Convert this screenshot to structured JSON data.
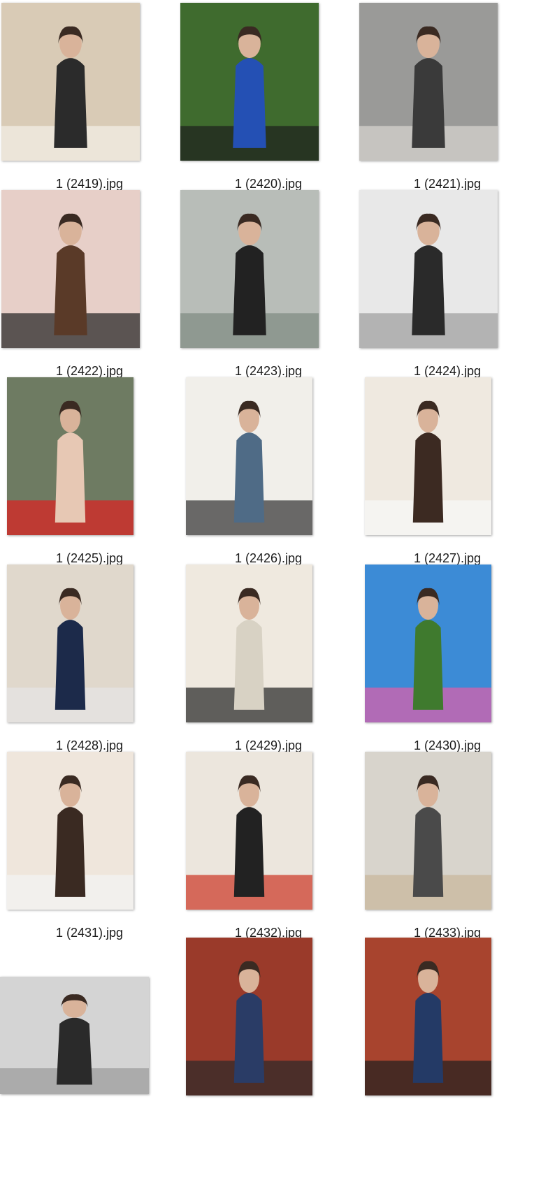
{
  "window": {
    "view": "File Explorer thumbnail view (large icons)"
  },
  "files": [
    {
      "name": "1 (2419).jpg",
      "thumb": {
        "orientation": "portrait",
        "palette": [
          "#d9cbb6",
          "#2b2b2b",
          "#f3efe8"
        ]
      }
    },
    {
      "name": "1 (2420).jpg",
      "thumb": {
        "orientation": "portrait",
        "palette": [
          "#3f6b2e",
          "#2450b4",
          "#1e1e1e"
        ]
      }
    },
    {
      "name": "1 (2421).jpg",
      "thumb": {
        "orientation": "portrait",
        "palette": [
          "#9a9a98",
          "#3a3a3a",
          "#d8d6d2"
        ]
      }
    },
    {
      "name": "1 (2422).jpg",
      "thumb": {
        "orientation": "portrait",
        "palette": [
          "#e7cfc8",
          "#5a3a28",
          "#1f1f1f"
        ]
      }
    },
    {
      "name": "1 (2423).jpg",
      "thumb": {
        "orientation": "portrait",
        "palette": [
          "#b8bdb8",
          "#222222",
          "#7e8a80"
        ]
      }
    },
    {
      "name": "1 (2424).jpg",
      "thumb": {
        "orientation": "portrait",
        "palette": [
          "#e8e8e8",
          "#2a2a2a",
          "#9c9c9c"
        ]
      }
    },
    {
      "name": "1 (2425).jpg",
      "thumb": {
        "orientation": "portrait",
        "palette": [
          "#6e7b62",
          "#e7c8b4",
          "#e02020"
        ]
      }
    },
    {
      "name": "1 (2426).jpg",
      "thumb": {
        "orientation": "portrait",
        "palette": [
          "#f1efea",
          "#4f6b86",
          "#2f2f2f"
        ]
      }
    },
    {
      "name": "1 (2427).jpg",
      "thumb": {
        "orientation": "portrait",
        "palette": [
          "#efe9e0",
          "#3c2a22",
          "#f8f8f8"
        ]
      }
    },
    {
      "name": "1 (2428).jpg",
      "thumb": {
        "orientation": "portrait",
        "palette": [
          "#e0d8cc",
          "#1c2a4a",
          "#e6e6e6"
        ]
      }
    },
    {
      "name": "1 (2429).jpg",
      "thumb": {
        "orientation": "portrait",
        "palette": [
          "#efe9df",
          "#d8d2c4",
          "#222222"
        ]
      }
    },
    {
      "name": "1 (2430).jpg",
      "thumb": {
        "orientation": "portrait",
        "palette": [
          "#3c8bd6",
          "#3f7a2e",
          "#e25ea8"
        ]
      }
    },
    {
      "name": "1 (2431).jpg",
      "thumb": {
        "orientation": "portrait",
        "palette": [
          "#efe6dc",
          "#3a2a22",
          "#f4f4f4"
        ]
      }
    },
    {
      "name": "1 (2432).jpg",
      "thumb": {
        "orientation": "portrait",
        "palette": [
          "#ece6dd",
          "#222222",
          "#cc3322"
        ]
      }
    },
    {
      "name": "1 (2433).jpg",
      "thumb": {
        "orientation": "portrait",
        "palette": [
          "#d8d4cc",
          "#4a4a4a",
          "#c9b79a"
        ]
      }
    },
    {
      "name": "",
      "thumb": {
        "orientation": "landscape",
        "palette": [
          "#d4d4d4",
          "#2a2a2a",
          "#9a9a9a"
        ]
      }
    },
    {
      "name": "",
      "thumb": {
        "orientation": "portrait",
        "palette": [
          "#9a3a2a",
          "#2a3c66",
          "#2a2a2a"
        ]
      }
    },
    {
      "name": "",
      "thumb": {
        "orientation": "portrait",
        "palette": [
          "#a8442e",
          "#243a66",
          "#1f1f1f"
        ]
      }
    }
  ]
}
